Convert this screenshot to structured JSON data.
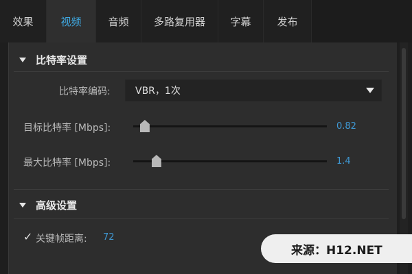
{
  "tabs": [
    {
      "label": "效果",
      "active": false
    },
    {
      "label": "视频",
      "active": true
    },
    {
      "label": "音频",
      "active": false
    },
    {
      "label": "多路复用器",
      "active": false
    },
    {
      "label": "字幕",
      "active": false
    },
    {
      "label": "发布",
      "active": false
    }
  ],
  "bitrate_section": {
    "title": "比特率设置",
    "encoding_label": "比特率编码:",
    "encoding_value": "VBR，1次",
    "target_label": "目标比特率 [Mbps]:",
    "target_value": "0.82",
    "target_level": 0.06,
    "max_label": "最大比特率 [Mbps]:",
    "max_value": "1.4",
    "max_level": 0.12
  },
  "advanced_section": {
    "title": "高级设置",
    "keyframe_checked": true,
    "keyframe_check_glyph": "✓",
    "keyframe_label": "关键帧距离:",
    "keyframe_value": "72"
  },
  "watermark": {
    "text": "来源：H12.NET"
  },
  "colors": {
    "accent": "#3fa7df",
    "value_text": "#3f9ad6",
    "panel": "#2d2d2d",
    "background": "#1e1e1e"
  }
}
